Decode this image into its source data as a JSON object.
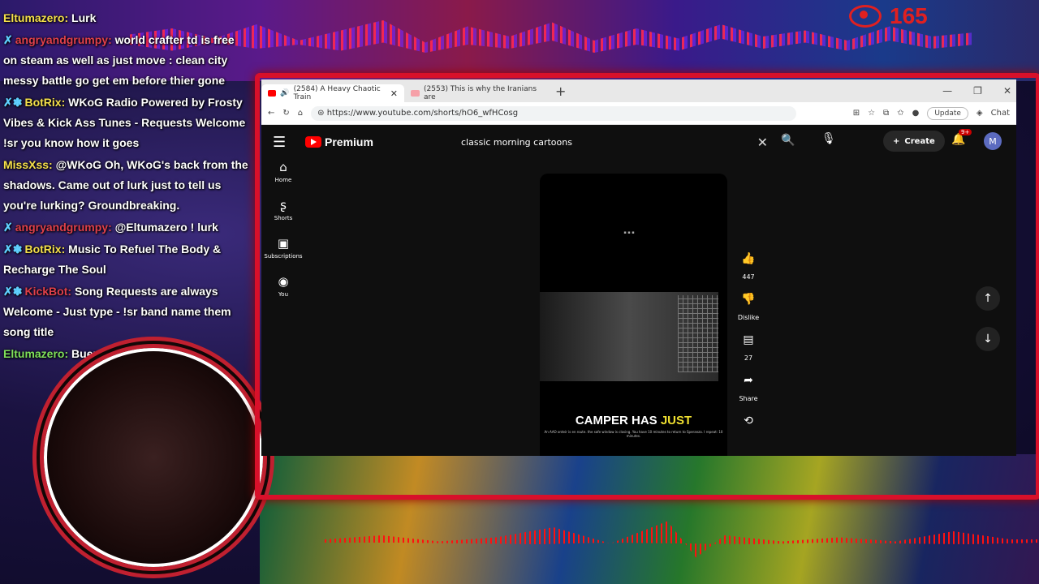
{
  "chat": [
    {
      "user": "Eltumazero",
      "user_class": "user-y",
      "badge": "",
      "text": "Lurk"
    },
    {
      "user": "angryandgrumpy",
      "user_class": "user-r",
      "badge": "✗",
      "text": "world crafter td is free on steam as well as just move : clean city messy battle go get em before thier gone"
    },
    {
      "user": "BotRix",
      "user_class": "user-y",
      "badge": "✗✽",
      "text": "WKoG Radio Powered by Frosty Vibes & Kick Ass Tunes - Requests Welcome !sr you know how it goes"
    },
    {
      "user": "MissXss",
      "user_class": "user-y",
      "badge": "",
      "text": "@WKoG Oh, WKoG's back from the shadows. Came out of lurk just to tell us you're lurking? Groundbreaking."
    },
    {
      "user": "angryandgrumpy",
      "user_class": "user-r",
      "badge": "✗",
      "text": "@Eltumazero ! lurk"
    },
    {
      "user": "BotRix",
      "user_class": "user-y",
      "badge": "✗✽",
      "text": "Music To Refuel The Body & Recharge The Soul"
    },
    {
      "user": "KickBot",
      "user_class": "user-r",
      "badge": "✗✽",
      "text": "Song Requests are always Welcome - Just type - !sr band name them song title"
    },
    {
      "user": "Eltumazero",
      "user_class": "user-g",
      "badge": "",
      "text": "Buena suerte. Good vib"
    }
  ],
  "viewers": {
    "count": "165",
    "icon": "eye-icon"
  },
  "browser": {
    "tabs": [
      {
        "label": "(2584) A Heavy Chaotic Train",
        "active": true
      },
      {
        "label": "(2553) This is why the Iranians are",
        "active": false
      }
    ],
    "url": "https://www.youtube.com/shorts/hO6_wfHCosg",
    "update_label": "Update",
    "chat_label": "Chat"
  },
  "youtube": {
    "logo": "Premium",
    "search_value": "classic morning cartoons",
    "create_label": "Create",
    "notif_count": "9+",
    "avatar_letter": "M",
    "nav": [
      {
        "label": "Home",
        "icon": "home-icon",
        "glyph": "⌂"
      },
      {
        "label": "Shorts",
        "icon": "shorts-icon",
        "glyph": "ʂ"
      },
      {
        "label": "Subscriptions",
        "icon": "subscriptions-icon",
        "glyph": "▣"
      },
      {
        "label": "You",
        "icon": "account-icon",
        "glyph": "◉"
      }
    ],
    "short": {
      "caption_main": "CAMPER HAS ",
      "caption_highlight": "JUST",
      "subtitle": "An AAO onteir is en route. the safe window is closing. You have 10 minutes to return to Speranza. I repeat: 10 minutes."
    },
    "actions": [
      {
        "name": "like",
        "icon": "thumbs-up-icon",
        "glyph": "👍",
        "label": "447"
      },
      {
        "name": "dislike",
        "icon": "thumbs-down-icon",
        "glyph": "👎",
        "label": "Dislike"
      },
      {
        "name": "comments",
        "icon": "comment-icon",
        "glyph": "▤",
        "label": "27"
      },
      {
        "name": "share",
        "icon": "share-icon",
        "glyph": "➦",
        "label": "Share"
      },
      {
        "name": "remix",
        "icon": "remix-icon",
        "glyph": "⟲",
        "label": ""
      }
    ]
  }
}
